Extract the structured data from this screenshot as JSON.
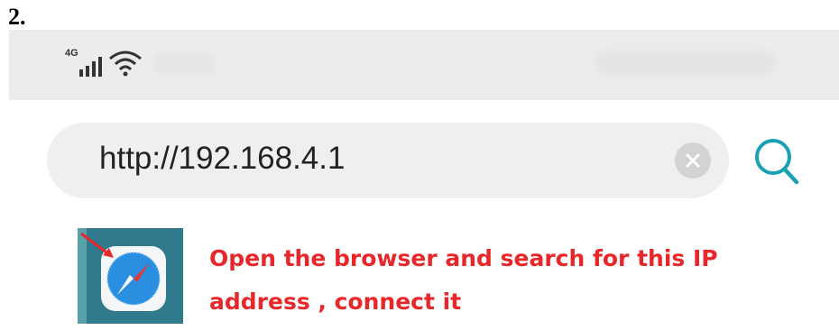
{
  "step_label": "2.",
  "status_bar": {
    "network_type": "4G",
    "signal_icon": "signal-bars-icon",
    "wifi_icon": "wifi-icon"
  },
  "browser": {
    "url_value": "http://192.168.4.1",
    "clear_icon": "clear-circle-icon",
    "search_icon": "search-icon",
    "accent_color": "#1aa0b3"
  },
  "instruction": {
    "app_icon": "safari-compass-icon",
    "line1": "Open the browser and search for this IP",
    "line2": "address , connect it",
    "color": "#e8272a"
  }
}
